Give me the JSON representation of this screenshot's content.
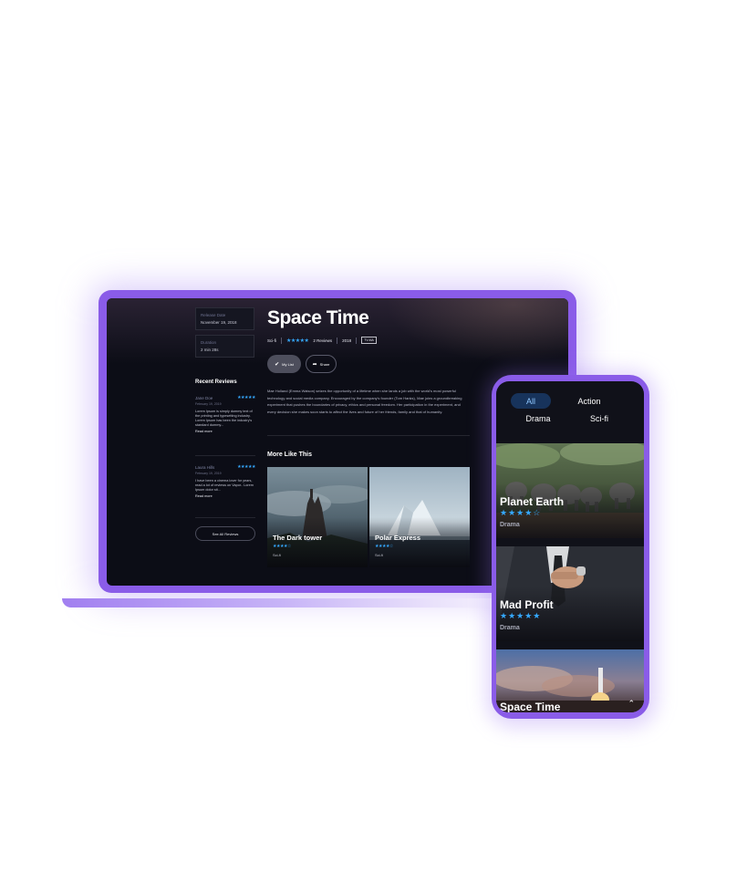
{
  "laptop": {
    "info": {
      "release_label": "Release Date",
      "release_value": "November 19, 2018",
      "duration_label": "Duration",
      "duration_value": "2 min 28s"
    },
    "recent_reviews_title": "Recent Reviews",
    "reviews": [
      {
        "name": "Jane Doe",
        "stars": "★★★★★",
        "date": "February 19, 2019",
        "text": "Lorem Ipsum is simply dummy text of the printing and typesetting industry. Lorem Ipsum has been the industry's standard dummy...",
        "link": "Read more"
      },
      {
        "name": "Laura Hills",
        "stars": "★★★★★",
        "date": "February 19, 2019",
        "text": "I have been a cinema lover for years, read a lot of reviews on Vapor.. Lorem Ipsum dolor sit...",
        "link": "Read more"
      }
    ],
    "see_all_label": "See All Reviews",
    "movie": {
      "title": "Space Time",
      "genre": "Sci-fi",
      "stars": "★★★★★",
      "reviews": "2 Reviews",
      "year": "2018",
      "rating": "TV-MA",
      "my_list_label": "My List",
      "share_label": "Share",
      "description": "Mae Holland (Emma Watson) seizes the opportunity of a lifetime when she lands a job with the world's most powerful technology and social media company. Encouraged by the company's founder (Tom Hanks), Mae joins a groundbreaking experiment that pushes the boundaries of privacy, ethics and personal freedom. Her participation in the experiment, and every decision she makes soon starts to affect the lives and future of her friends, family and that of humanity."
    },
    "more_like_this_title": "More Like This",
    "cards": [
      {
        "title": "The Dark tower",
        "stars": "★★★★☆",
        "genre": "Sci-fi"
      },
      {
        "title": "Polar Express",
        "stars": "★★★★☆",
        "genre": "Sci-fi"
      }
    ]
  },
  "phone": {
    "tabs": [
      "All",
      "Action",
      "Drama",
      "Sci-fi"
    ],
    "active_tab": "All",
    "cards": [
      {
        "title": "Planet Earth",
        "stars": "★★★★☆",
        "genre": "Drama"
      },
      {
        "title": "Mad Profit",
        "stars": "★★★★★",
        "genre": "Drama"
      },
      {
        "title": "Space Time"
      }
    ]
  },
  "colors": {
    "accent_purple": "#8a5ce8",
    "star_blue": "#35a9ff",
    "screen_dark": "#0c0d16",
    "active_tab": "#17335b"
  }
}
